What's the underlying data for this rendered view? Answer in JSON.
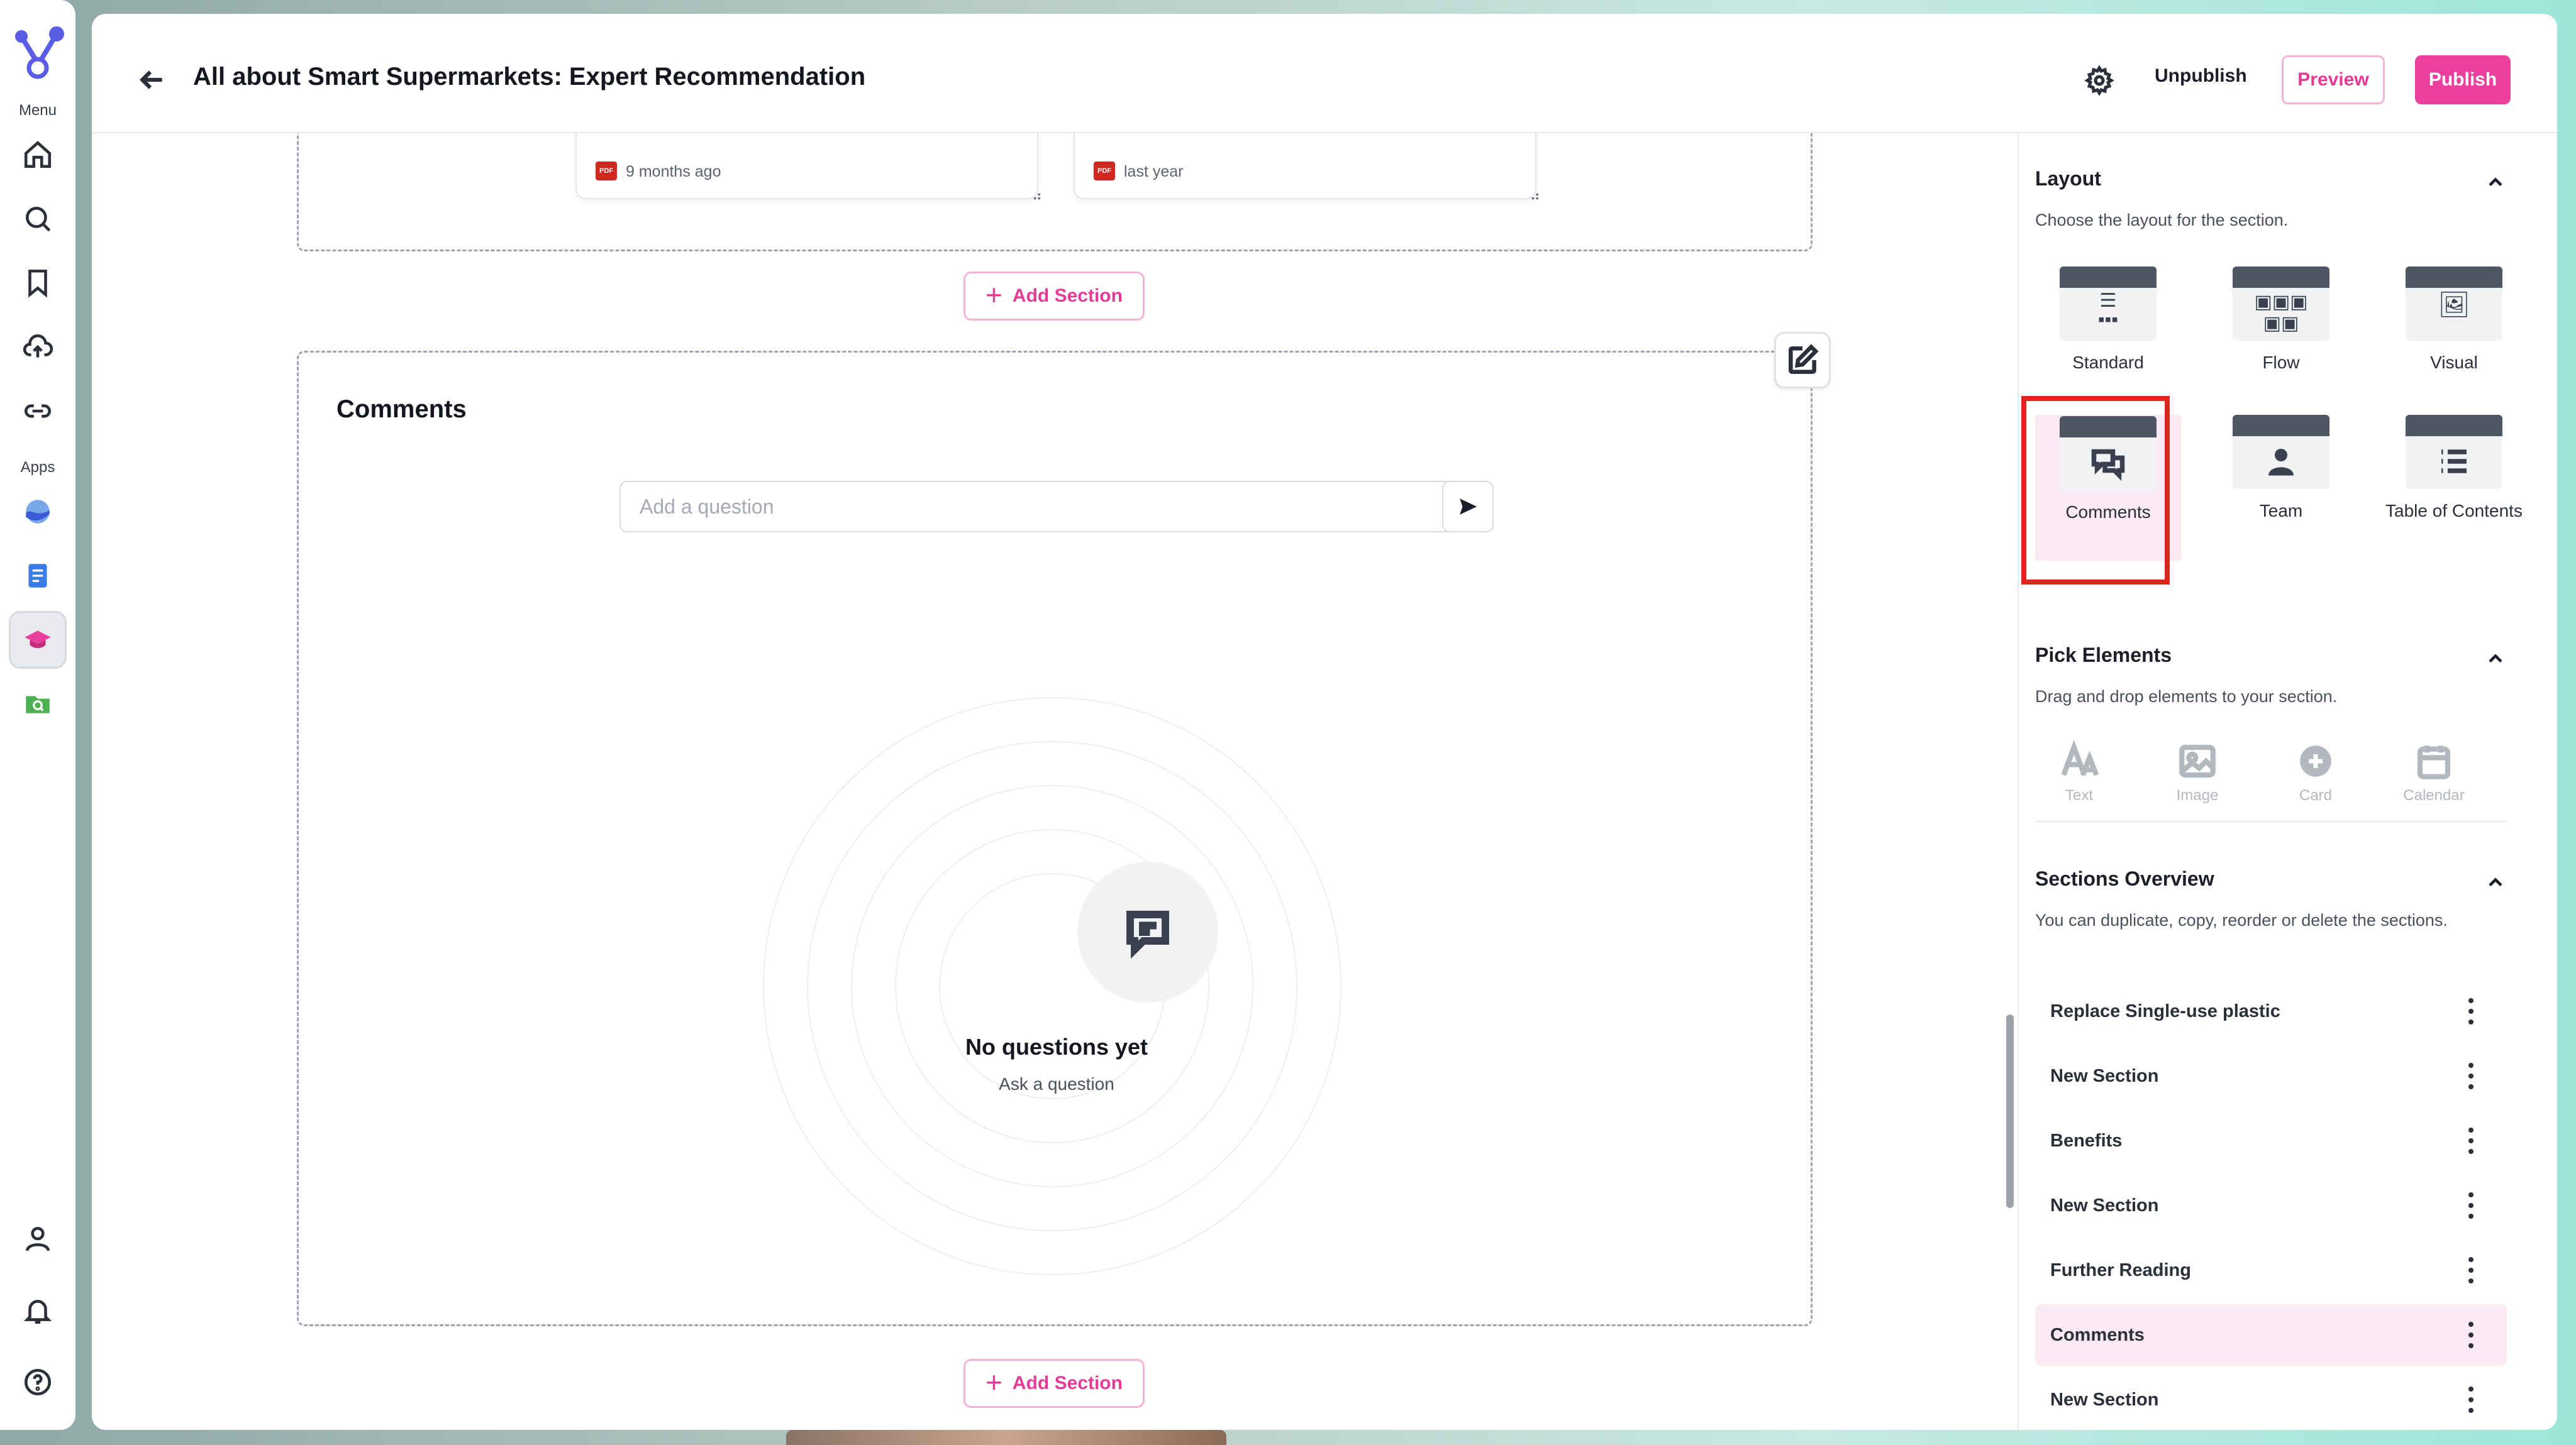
{
  "rail": {
    "menu_label": "Menu",
    "apps_label": "Apps",
    "nav_icons": [
      "home-icon",
      "search-icon",
      "bookmark-icon",
      "cloud-upload-icon",
      "link-icon"
    ],
    "app_icons": [
      "wave-app-icon",
      "document-app-icon",
      "learning-app-icon",
      "folder-search-app-icon"
    ],
    "bottom_icons": [
      "user-icon",
      "bell-icon",
      "help-icon"
    ]
  },
  "header": {
    "title": "All about Smart Supermarkets: Expert Recommendation",
    "unpublish": "Unpublish",
    "preview": "Preview",
    "publish": "Publish",
    "accent_color": "#ea3f9c"
  },
  "canvas": {
    "file_cards": [
      {
        "badge": "PDF",
        "time": "9 months ago"
      },
      {
        "badge": "PDF",
        "time": "last year"
      }
    ],
    "add_section_label": "Add Section",
    "comments": {
      "heading": "Comments",
      "input_placeholder": "Add a question",
      "empty_title": "No questions yet",
      "empty_subtitle": "Ask a question"
    }
  },
  "panel": {
    "layout": {
      "heading": "Layout",
      "description": "Choose the layout for the section.",
      "options": [
        "Standard",
        "Flow",
        "Visual",
        "Comments",
        "Team",
        "Table of Contents"
      ],
      "selected": "Comments"
    },
    "pick_elements": {
      "heading": "Pick Elements",
      "description": "Drag and drop elements to your section.",
      "items": [
        "Text",
        "Image",
        "Card",
        "Calendar"
      ]
    },
    "sections_overview": {
      "heading": "Sections Overview",
      "description": "You can duplicate, copy, reorder or delete the sections.",
      "items": [
        "Replace Single-use plastic",
        "New Section",
        "Benefits",
        "New Section",
        "Further Reading",
        "Comments",
        "New Section"
      ],
      "active": "Comments"
    }
  }
}
